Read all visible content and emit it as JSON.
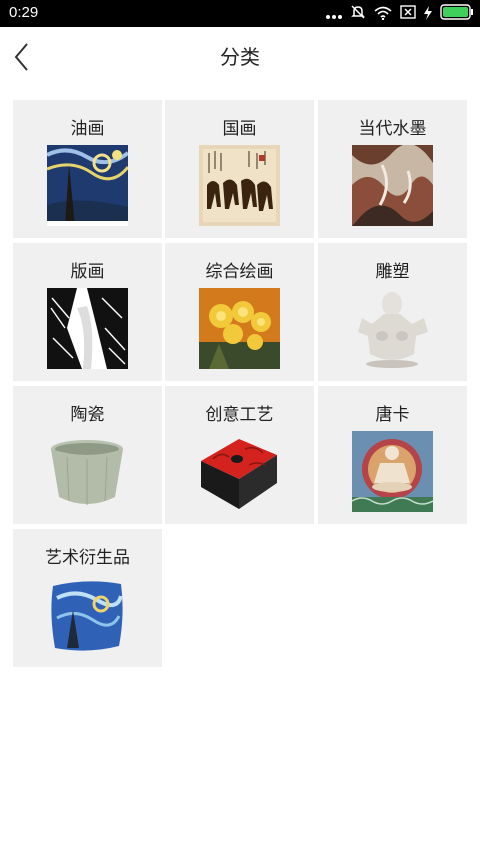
{
  "status_bar": {
    "time": "0:29",
    "icons": [
      "dots-icon",
      "mute-icon",
      "wifi-icon",
      "sim-x-icon",
      "charging-icon",
      "battery-icon"
    ]
  },
  "header": {
    "title": "分类",
    "back_icon": "chevron-left-icon"
  },
  "categories": [
    {
      "label": "油画"
    },
    {
      "label": "国画"
    },
    {
      "label": "当代水墨"
    },
    {
      "label": "版画"
    },
    {
      "label": "综合绘画"
    },
    {
      "label": "雕塑"
    },
    {
      "label": "陶瓷"
    },
    {
      "label": "创意工艺"
    },
    {
      "label": "唐卡"
    },
    {
      "label": "艺术衍生品"
    }
  ],
  "colors": {
    "status_bg": "#000000",
    "tile_bg": "#f0f0f0",
    "battery": "#3ed05b"
  }
}
